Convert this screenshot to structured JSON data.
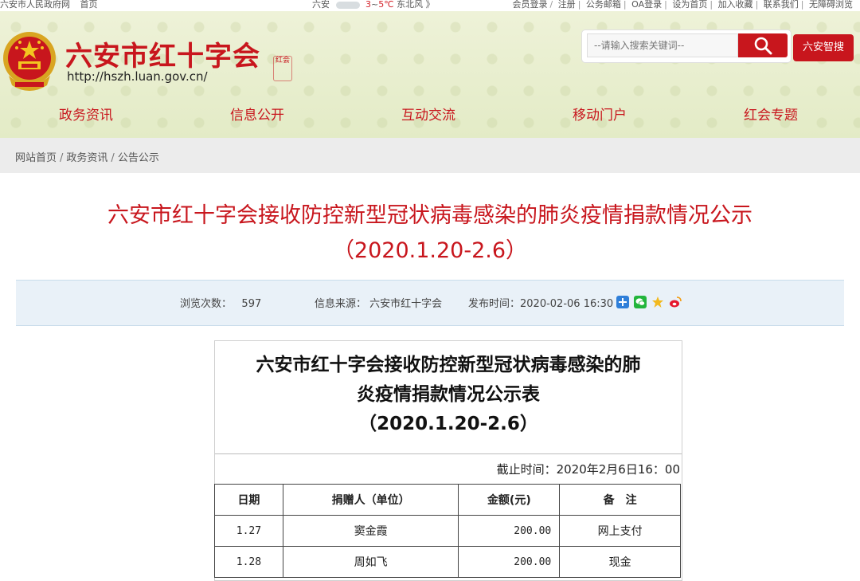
{
  "topbar": {
    "left_links": [
      "六安市人民政府网",
      "首页"
    ],
    "weather": {
      "city": "六安",
      "low": "3",
      "sep": "~",
      "high": "5",
      "unit": "℃",
      "wind": "东北风",
      "more": "》"
    },
    "right_links": [
      "会员登录",
      "注册",
      "公务邮箱",
      "OA登录",
      "设为首页",
      "加入收藏",
      "联系我们",
      "无障碍浏览"
    ]
  },
  "header": {
    "site_title": "六安市红十字会",
    "site_url": "http://hszh.luan.gov.cn/",
    "seal_text": "红会",
    "search_placeholder": "--请输入搜索关键词--",
    "zhisou_label": "六安智搜",
    "colors": {
      "brand_red": "#c8161d"
    }
  },
  "nav": {
    "items": [
      "政务资讯",
      "信息公开",
      "互动交流",
      "移动门户",
      "红会专题"
    ]
  },
  "breadcrumb": {
    "items": [
      "网站首页",
      "政务资讯",
      "公告公示"
    ],
    "separator": "/"
  },
  "article": {
    "title_line1": "六安市红十字会接收防控新型冠状病毒感染的肺炎疫情捐款情况公示",
    "title_line2": "（2020.1.20-2.6）",
    "views_label": "浏览次数：",
    "views_value": "597",
    "source_label": "信息来源：",
    "source_value": "六安市红十字会",
    "date_label": "发布时间：",
    "date_value": "2020-02-06 16:30",
    "share_icons": [
      "plus-icon",
      "wechat-icon",
      "qzone-star-icon",
      "weibo-icon"
    ]
  },
  "document": {
    "title_line1": "六安市红十字会接收防控新型冠状病毒感染的肺",
    "title_line2": "炎疫情捐款情况公示表",
    "title_line3": "（2020.1.20-2.6）",
    "deadline": "截止时间：2020年2月6日16：00",
    "columns": [
      "日期",
      "捐赠人（单位）",
      "金额(元)",
      "备　注"
    ],
    "rows": [
      {
        "date": "1.27",
        "donor": "窦金霞",
        "amount": "200.00",
        "note": "网上支付"
      },
      {
        "date": "1.28",
        "donor": "周如飞",
        "amount": "200.00",
        "note": "现金"
      }
    ]
  }
}
